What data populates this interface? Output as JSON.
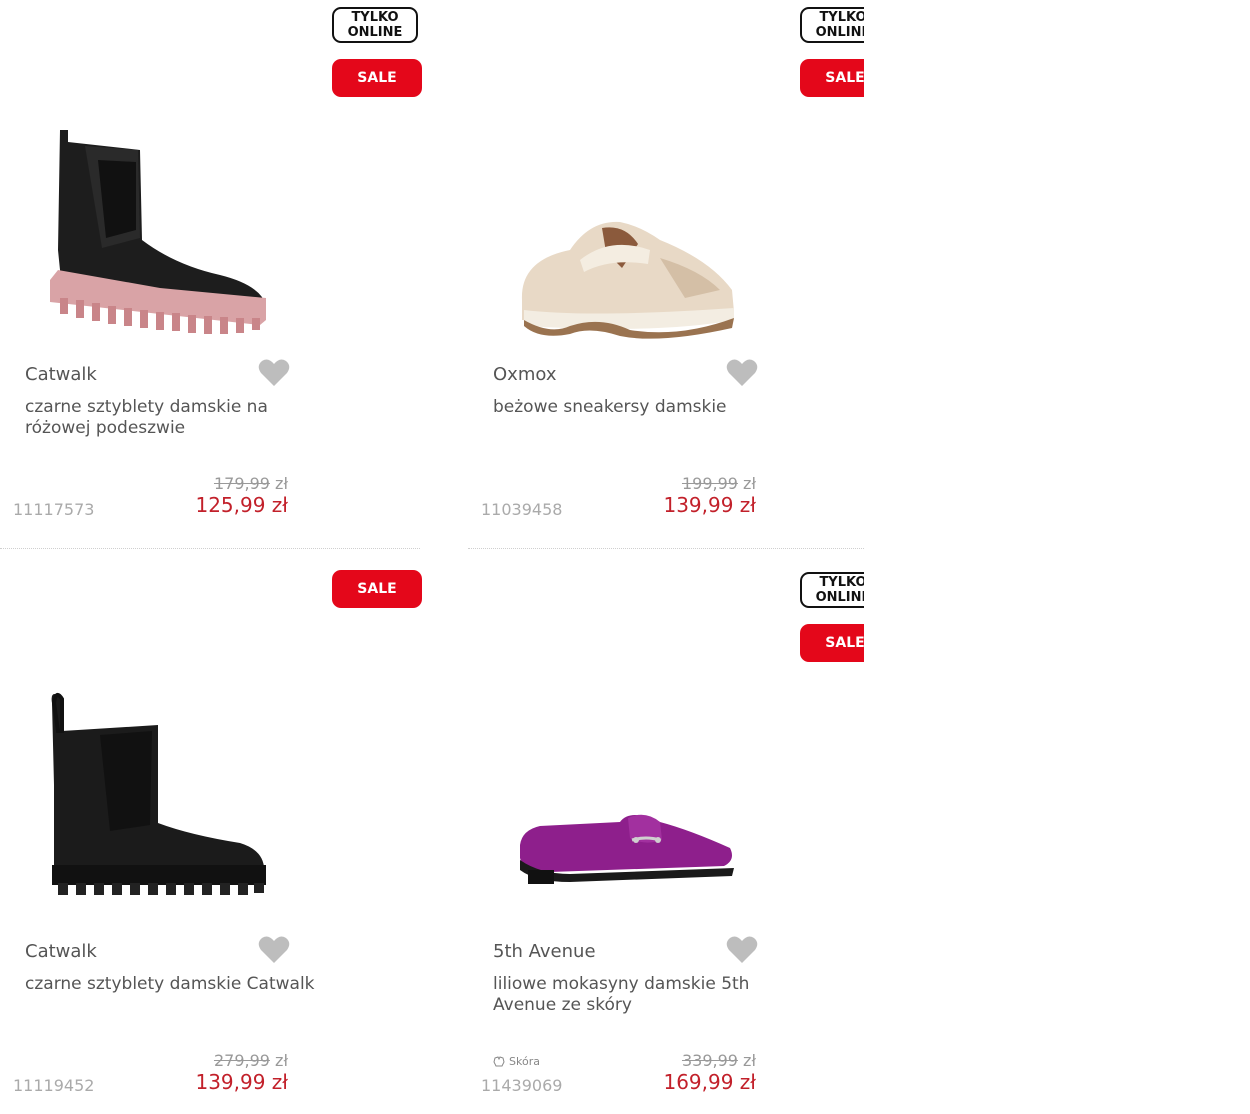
{
  "badges": {
    "online": "TYLKO\nONLINE",
    "sale": "SALE"
  },
  "products": [
    {
      "brand": "Catwalk",
      "name": "czarne sztyblety damskie na różowej podeszwie",
      "sku": "11117573",
      "old_price": "179,99",
      "old_unit": "zł",
      "new_price": "125,99 zł",
      "online": true,
      "image": "black-chelsea-boot-pink-sole"
    },
    {
      "brand": "Oxmox",
      "name": "beżowe sneakersy damskie",
      "sku": "11039458",
      "old_price": "199,99",
      "old_unit": "zł",
      "new_price": "139,99 zł",
      "online": true,
      "image": "beige-chunky-sneaker"
    },
    {
      "brand": "Catwalk",
      "name": "czarne sztyblety damskie Catwalk",
      "sku": "11119452",
      "old_price": "279,99",
      "old_unit": "zł",
      "new_price": "139,99 zł",
      "online": false,
      "image": "black-chelsea-boot"
    },
    {
      "brand": "5th Avenue",
      "name": "liliowe mokasyny damskie 5th Avenue ze skóry",
      "sku": "11439069",
      "old_price": "339,99",
      "old_unit": "zł",
      "new_price": "169,99 zł",
      "online": true,
      "material": "Skóra",
      "image": "purple-suede-loafer"
    }
  ],
  "colors": {
    "sale": "#e4071a",
    "price": "#c2202a",
    "heart": "#bdbdbd"
  }
}
